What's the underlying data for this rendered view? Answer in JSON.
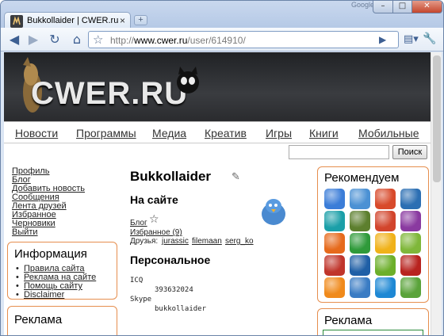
{
  "browser": {
    "tab_title": "Bukkollaider | CWER.ru",
    "tab_close": "×",
    "new_tab": "+",
    "search_brand": "Google",
    "url_prefix": "http://",
    "url_domain": "www.cwer.ru",
    "url_path": "/user/614910/"
  },
  "site": {
    "logo": "CWER.RU",
    "nav": [
      "Новости",
      "Программы",
      "Медиа",
      "Креатив",
      "Игры",
      "Книги",
      "Мобильные"
    ],
    "search_button": "Поиск"
  },
  "user_menu": [
    "Профиль",
    "Блог",
    "Добавить новость",
    "Сообщения",
    "Лента друзей",
    "Избранное",
    "Черновики",
    "Выйти"
  ],
  "info_box": {
    "title": "Информация",
    "links": [
      "Правила сайта",
      "Реклама на сайте",
      "Помощь сайту",
      "Disclaimer"
    ]
  },
  "ads_left_title": "Реклама",
  "profile": {
    "username": "Bukkollaider",
    "on_site_heading": "На сайте",
    "blog_link": "Блог",
    "favorites_link": "Избранное (9)",
    "friends_label": "Друзья:",
    "friends": [
      "jurassic",
      "filemaan",
      "serg_ko"
    ],
    "personal_heading": "Персональное",
    "icq_label": "ICQ",
    "icq_value": "393632024",
    "skype_label": "Skype",
    "skype_value": "bukkollaider"
  },
  "recommend": {
    "title": "Рекомендуем",
    "icons": [
      {
        "name": "windows-icon",
        "color": "#3b7dd8"
      },
      {
        "name": "bird-app-icon",
        "color": "#4b91d4"
      },
      {
        "name": "record-app-icon",
        "color": "#d84a2b"
      },
      {
        "name": "globe-app-icon",
        "color": "#2c6fb3"
      },
      {
        "name": "teal-app-icon",
        "color": "#1b9fa8"
      },
      {
        "name": "bug-app-icon",
        "color": "#5d7f2e"
      },
      {
        "name": "ccleaner-icon",
        "color": "#d2452c"
      },
      {
        "name": "winrar-icon",
        "color": "#8a3aa0"
      },
      {
        "name": "firefox-icon",
        "color": "#e66a1c"
      },
      {
        "name": "green-robot-icon",
        "color": "#2f9a3a"
      },
      {
        "name": "bat-app-icon",
        "color": "#f0b21a"
      },
      {
        "name": "tool-app-icon",
        "color": "#7fb73a"
      },
      {
        "name": "shield-app-icon",
        "color": "#c0352b"
      },
      {
        "name": "photoshop-icon",
        "color": "#1f5fa6"
      },
      {
        "name": "xn-app-icon",
        "color": "#6caf2a"
      },
      {
        "name": "red-box-icon",
        "color": "#b8231f"
      },
      {
        "name": "aimp-icon",
        "color": "#f08a1b"
      },
      {
        "name": "x-app-icon",
        "color": "#3a7cc4"
      },
      {
        "name": "blue-wave-icon",
        "color": "#1e88d4"
      },
      {
        "name": "money-app-icon",
        "color": "#5aa33a"
      }
    ]
  },
  "ads_right_title": "Реклама"
}
